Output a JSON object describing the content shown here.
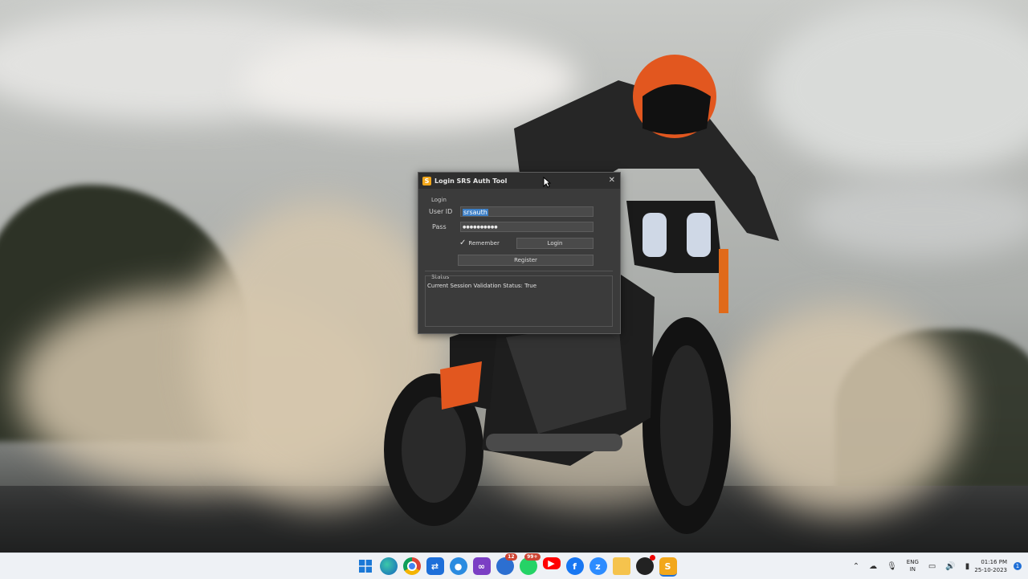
{
  "window": {
    "title": "Login SRS Auth Tool",
    "close_glyph": "✕",
    "login_group": "Login",
    "user_id_label": "User ID",
    "user_id_value": "srsauth",
    "pass_label": "Pass",
    "pass_value": "●●●●●●●●●●",
    "remember_label": "Remember",
    "remember_checked": true,
    "login_button": "Login",
    "register_button": "Register",
    "status_group": "Status",
    "status_text": "Current Session Validation Status: True"
  },
  "taskbar": {
    "icons": [
      "windows-start",
      "edge",
      "chrome",
      "teamviewer",
      "browser-blue",
      "visual-studio",
      "app-badge",
      "whatsapp",
      "youtube",
      "facebook",
      "zoom",
      "file-explorer",
      "obs",
      "srs-auth"
    ],
    "badges": {
      "app_badge": "12",
      "whatsapp": "99+"
    },
    "language": "ENG",
    "region": "IN",
    "time": "01:16 PM",
    "date": "25-10-2023",
    "notification_count": "1"
  }
}
